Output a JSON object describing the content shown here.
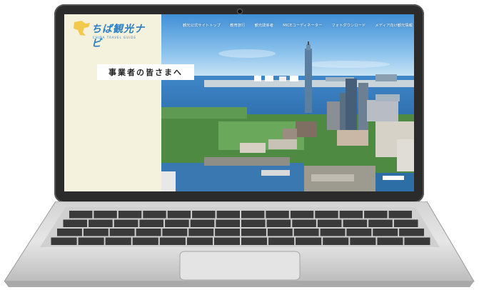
{
  "site": {
    "logo_main": "ちば観光ナビ",
    "logo_sub": "CHIBA TRAVEL GUIDE"
  },
  "nav": {
    "items": [
      {
        "label": "観光公式サイトトップ"
      },
      {
        "label": "教育旅行"
      },
      {
        "label": "観光関係者"
      },
      {
        "label": "MICEコーディネーター"
      },
      {
        "label": "フォトダウンロード"
      },
      {
        "label": "メディア向け観光情報"
      }
    ]
  },
  "hero": {
    "heading": "事業者の皆さまへ"
  },
  "colors": {
    "cream": "#f4f1dc",
    "brand": "#2a7fc4",
    "logo_accent": "#f2c94c"
  },
  "icons": {
    "logo_mark": "chiba-map-icon"
  }
}
